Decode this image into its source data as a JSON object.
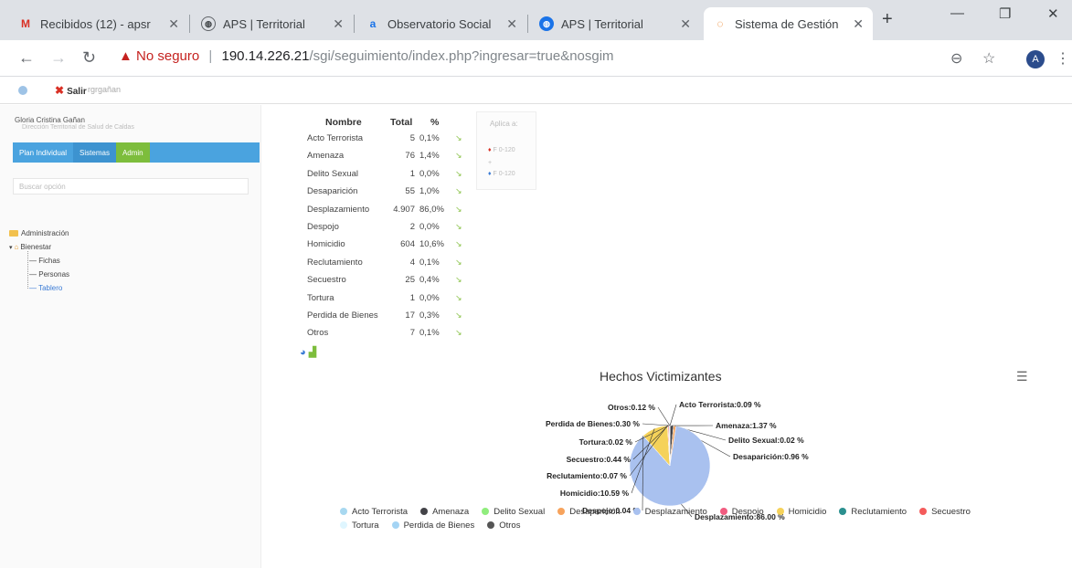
{
  "browser": {
    "tabs": [
      {
        "label": "Recibidos (12) - apsr",
        "icon": "gmail-icon"
      },
      {
        "label": "APS | Territorial",
        "icon": "globe-icon"
      },
      {
        "label": "Observatorio Social",
        "icon": "amazon-icon"
      },
      {
        "label": "APS | Territorial",
        "icon": "globe-icon"
      },
      {
        "label": "Sistema de Gestión",
        "icon": "loading-icon"
      }
    ],
    "security_label": "No seguro",
    "url_host": "190.14.226.21",
    "url_path": "/sgi/seguimiento/index.php?ingresar=true&nosgim",
    "avatar_letter": "A"
  },
  "app": {
    "logout_label": "Salir",
    "username_small": "rgrgañan",
    "user_name": "Gloria Cristina Gañan",
    "user_role": "Dirección Territorial de Salud de Caldas",
    "tabs": [
      "Plan Individual",
      "Sistemas",
      "Admin"
    ],
    "search_placeholder": "Buscar opción",
    "tree": {
      "root": "Administración",
      "group": "Bienestar",
      "items": [
        "Fichas",
        "Personas",
        "Tablero"
      ]
    }
  },
  "stats_table": {
    "headers": [
      "Nombre",
      "Total",
      "%"
    ],
    "rows": [
      {
        "name": "Acto Terrorista",
        "total": "5",
        "pct": "0,1%"
      },
      {
        "name": "Amenaza",
        "total": "76",
        "pct": "1,4%"
      },
      {
        "name": "Delito Sexual",
        "total": "1",
        "pct": "0,0%"
      },
      {
        "name": "Desaparición",
        "total": "55",
        "pct": "1,0%"
      },
      {
        "name": "Desplazamiento",
        "total": "4.907",
        "pct": "86,0%"
      },
      {
        "name": "Despojo",
        "total": "2",
        "pct": "0,0%"
      },
      {
        "name": "Homicidio",
        "total": "604",
        "pct": "10,6%"
      },
      {
        "name": "Reclutamiento",
        "total": "4",
        "pct": "0,1%"
      },
      {
        "name": "Secuestro",
        "total": "25",
        "pct": "0,4%"
      },
      {
        "name": "Tortura",
        "total": "1",
        "pct": "0,0%"
      },
      {
        "name": "Perdida de Bienes",
        "total": "17",
        "pct": "0,3%"
      },
      {
        "name": "Otros",
        "total": "7",
        "pct": "0,1%"
      }
    ]
  },
  "aplica": {
    "title": "Aplica a:",
    "rows": [
      "F 0-120",
      "F 0-120"
    ]
  },
  "chart_data": {
    "type": "pie",
    "title": "Hechos Victimizantes",
    "slices": [
      {
        "name": "Acto Terrorista",
        "value": 0.09,
        "label": "Acto Terrorista:0.09 %",
        "color": "#a8d8f0"
      },
      {
        "name": "Amenaza",
        "value": 1.37,
        "label": "Amenaza:1.37 %",
        "color": "#434348"
      },
      {
        "name": "Delito Sexual",
        "value": 0.02,
        "label": "Delito Sexual:0.02 %",
        "color": "#90ed7d"
      },
      {
        "name": "Desaparición",
        "value": 0.96,
        "label": "Desaparición:0.96 %",
        "color": "#f7a35c"
      },
      {
        "name": "Desplazamiento",
        "value": 86.0,
        "label": "Desplazamiento:86.00 %",
        "color": "#a9c1ef"
      },
      {
        "name": "Despojo",
        "value": 0.04,
        "label": "Despojo:0.04 %",
        "color": "#f15c80"
      },
      {
        "name": "Homicidio",
        "value": 10.59,
        "label": "Homicidio:10.59 %",
        "color": "#f5d25a"
      },
      {
        "name": "Reclutamiento",
        "value": 0.07,
        "label": "Reclutamiento:0.07 %",
        "color": "#2b908f"
      },
      {
        "name": "Secuestro",
        "value": 0.44,
        "label": "Secuestro:0.44 %",
        "color": "#f45b5b"
      },
      {
        "name": "Tortura",
        "value": 0.02,
        "label": "Tortura:0.02 %",
        "color": "#dff6ff"
      },
      {
        "name": "Perdida de Bienes",
        "value": 0.3,
        "label": "Perdida de Bienes:0.30 %",
        "color": "#a4d4f4"
      },
      {
        "name": "Otros",
        "value": 0.12,
        "label": "Otros:0.12 %",
        "color": "#555555"
      }
    ],
    "legend_position": "bottom"
  }
}
